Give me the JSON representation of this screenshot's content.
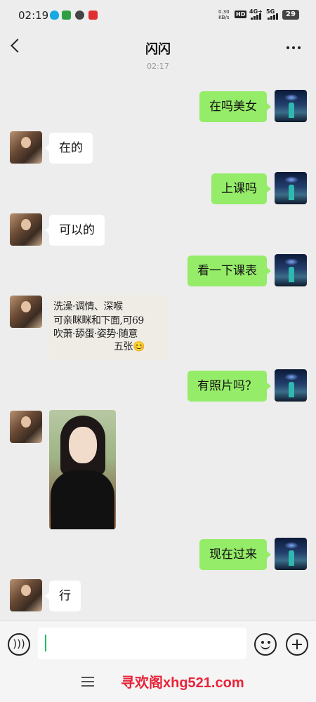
{
  "status_bar": {
    "time": "02:19",
    "net_speed_value": "0.30",
    "net_speed_unit": "KB/s",
    "hd_label": "HD",
    "net1": "4G+",
    "net2": "5G",
    "battery": "29"
  },
  "header": {
    "title": "闪闪"
  },
  "chat": {
    "timestamp": "02:17",
    "messages": [
      {
        "from": "me",
        "type": "text",
        "text": "在吗美女"
      },
      {
        "from": "other",
        "type": "text",
        "text": "在的"
      },
      {
        "from": "me",
        "type": "text",
        "text": "上课吗"
      },
      {
        "from": "other",
        "type": "text",
        "text": "可以的"
      },
      {
        "from": "me",
        "type": "text",
        "text": "看一下课表"
      },
      {
        "from": "other",
        "type": "image",
        "lines": [
          "洗澡·调情、深喉",
          "可亲眯眯和下面,可69",
          "吹萧·舔蛋·姿势·随意",
          "五张😊"
        ]
      },
      {
        "from": "me",
        "type": "text",
        "text": "有照片吗？"
      },
      {
        "from": "other",
        "type": "image",
        "text": ""
      },
      {
        "from": "me",
        "type": "text",
        "text": "现在过来"
      },
      {
        "from": "other",
        "type": "text",
        "text": "行"
      }
    ]
  },
  "input_bar": {
    "value": "",
    "icons": [
      "voice-icon",
      "emoji-icon",
      "plus-icon"
    ]
  },
  "bottom": {
    "watermark": "寻欢阁xhg521.com"
  },
  "colors": {
    "background": "#ededed",
    "my_bubble": "#95ec69",
    "other_bubble": "#ffffff",
    "watermark": "#e8233a"
  }
}
